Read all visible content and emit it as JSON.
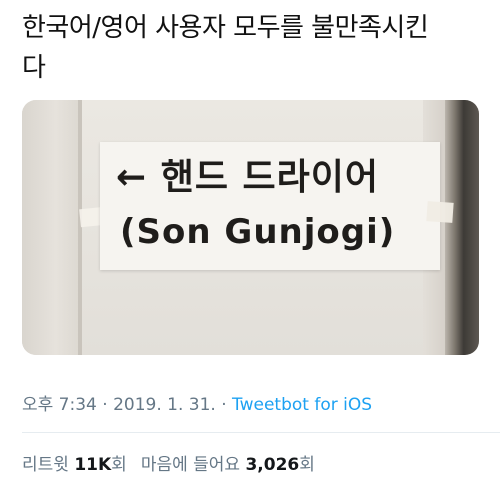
{
  "tweet": {
    "text_line1": "한국어/영어 사용자 모두를 불만족시킨",
    "text_line2": "다"
  },
  "media": {
    "sign_line1": "← 핸드 드라이어",
    "sign_line2": "(Son Gunjogi)"
  },
  "meta": {
    "time": "오후 7:34",
    "separator1": " · ",
    "date": "2019. 1. 31.",
    "separator2": " · ",
    "source": "Tweetbot for iOS"
  },
  "stats": {
    "retweets_label": "리트윗",
    "retweets_count": "11K",
    "retweets_suffix": "회",
    "likes_label": "마음에 들어요",
    "likes_count": "3,026",
    "likes_suffix": "회"
  },
  "colors": {
    "muted": "#657786",
    "link": "#1da1f2",
    "text": "#14171a"
  }
}
